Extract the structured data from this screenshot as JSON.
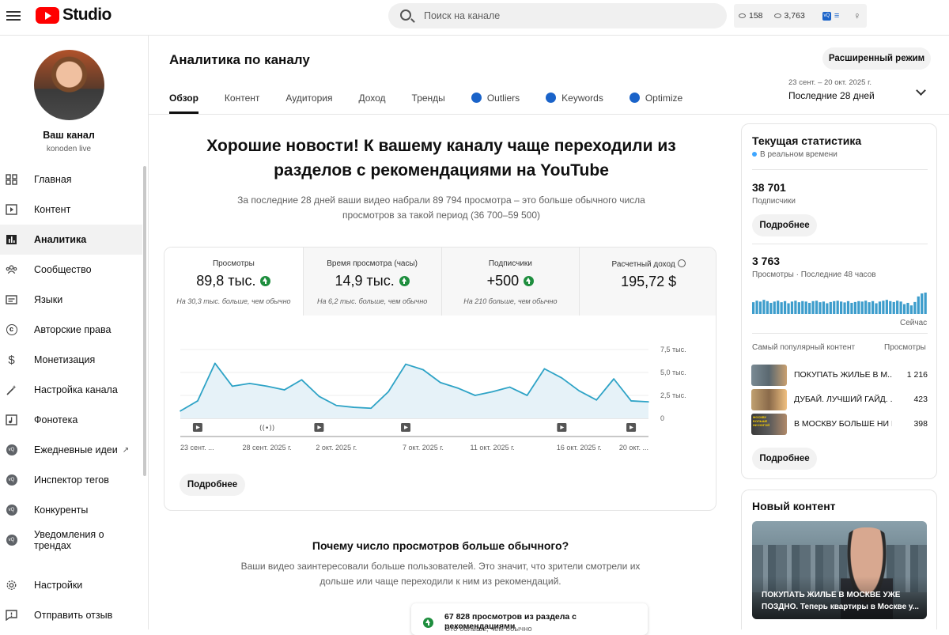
{
  "header": {
    "logo_text": "Studio",
    "search_placeholder": "Поиск на канале",
    "views_count": "158",
    "realtime_count": "3,763"
  },
  "sidebar": {
    "channel_name": "Ваш канал",
    "channel_handle": "konoden live",
    "items": [
      {
        "label": "Главная"
      },
      {
        "label": "Контент"
      },
      {
        "label": "Аналитика"
      },
      {
        "label": "Сообщество"
      },
      {
        "label": "Языки"
      },
      {
        "label": "Авторские права"
      },
      {
        "label": "Монетизация"
      },
      {
        "label": "Настройка канала"
      },
      {
        "label": "Фонотека"
      },
      {
        "label": "Ежедневные идеи"
      },
      {
        "label": "Инспектор тегов"
      },
      {
        "label": "Конкуренты"
      },
      {
        "label": "Уведомления о трендах"
      },
      {
        "label": "Настройки"
      },
      {
        "label": "Отправить отзыв"
      }
    ]
  },
  "main": {
    "title": "Аналитика по каналу",
    "advanced_button": "Расширенный режим",
    "tabs": [
      {
        "label": "Обзор"
      },
      {
        "label": "Контент"
      },
      {
        "label": "Аудитория"
      },
      {
        "label": "Доход"
      },
      {
        "label": "Тренды"
      },
      {
        "label": "Outliers"
      },
      {
        "label": "Keywords"
      },
      {
        "label": "Optimize"
      }
    ],
    "date_range": "23 сент. – 20 окт. 2025 г.",
    "date_label": "Последние 28 дней",
    "headline": "Хорошие новости! К вашему каналу чаще переходили из разделов с рекомендациями на YouTube",
    "subline": "За последние 28 дней ваши видео набрали 89 794 просмотра – это больше обычного числа просмотров за такой период (36 700–59 500)",
    "metrics": [
      {
        "title": "Просмотры",
        "value": "89,8 тыс.",
        "sub": "На 30,3 тыс. больше, чем обычно"
      },
      {
        "title": "Время просмотра (часы)",
        "value": "14,9 тыс.",
        "sub": "На 6,2 тыс. больше, чем обычно"
      },
      {
        "title": "Подписчики",
        "value": "+500",
        "sub": "На 210 больше, чем обычно"
      },
      {
        "title": "Расчетный доход",
        "value": "195,72 $",
        "sub": ""
      }
    ],
    "more_button": "Подробнее",
    "why_title": "Почему число просмотров больше обычного?",
    "why_sub": "Ваши видео заинтересовали больше пользователей. Это значит, что зрители смотрели их дольше или чаще переходили к ним из рекомендаций.",
    "rec_title": "67 828 просмотров из раздела с рекомендациями",
    "rec_sub": "Это больше, чем обычно"
  },
  "chart_data": {
    "type": "line",
    "x": [
      "23 сент.",
      "24 сент.",
      "25 сент.",
      "26 сент.",
      "27 сент.",
      "28 сент.",
      "29 сент.",
      "30 сент.",
      "1 окт.",
      "2 окт.",
      "3 окт.",
      "4 окт.",
      "5 окт.",
      "6 окт.",
      "7 окт.",
      "8 окт.",
      "9 окт.",
      "10 окт.",
      "11 окт.",
      "12 окт.",
      "13 окт.",
      "14 окт.",
      "15 окт.",
      "16 окт.",
      "17 окт.",
      "18 окт.",
      "19 окт.",
      "20 окт."
    ],
    "values": [
      800,
      1900,
      6000,
      3500,
      3800,
      3500,
      3100,
      4200,
      2400,
      1400,
      1200,
      1100,
      2900,
      5900,
      5300,
      3900,
      3300,
      2500,
      2900,
      3400,
      2500,
      5400,
      4400,
      3000,
      2000,
      4300,
      1900,
      1800
    ],
    "xtick_labels": [
      "23 сент. ...",
      "28 сент. 2025 г.",
      "2 окт. 2025 г.",
      "7 окт. 2025 г.",
      "11 окт. 2025 г.",
      "16 окт. 2025 г.",
      "20 окт. ..."
    ],
    "xtick_index": [
      0,
      5,
      9,
      14,
      18,
      23,
      27
    ],
    "ytick_labels": [
      "7,5 тыс.",
      "5,0 тыс.",
      "2,5 тыс.",
      "0"
    ],
    "ytick_values": [
      7500,
      5000,
      2500,
      0
    ],
    "ylim": [
      0,
      7500
    ],
    "markers": [
      {
        "index": 1,
        "kind": "video"
      },
      {
        "index": 8,
        "kind": "video"
      },
      {
        "index": 5,
        "kind": "live"
      },
      {
        "index": 13,
        "kind": "video"
      },
      {
        "index": 22,
        "kind": "video"
      },
      {
        "index": 26,
        "kind": "video"
      }
    ],
    "line_color": "#2ea3c6",
    "fill_color": "#e6f2f8",
    "grid": true
  },
  "realtime": {
    "title": "Текущая статистика",
    "live_label": "В реальном времени",
    "subscribers_value": "38 701",
    "subscribers_label": "Подписчики",
    "more_button": "Подробнее",
    "views_value": "3 763",
    "views_label": "Просмотры · Последние 48 часов",
    "now_label": "Сейчас",
    "bars": [
      0.55,
      0.62,
      0.58,
      0.66,
      0.6,
      0.52,
      0.58,
      0.62,
      0.55,
      0.6,
      0.5,
      0.58,
      0.62,
      0.55,
      0.6,
      0.58,
      0.52,
      0.6,
      0.62,
      0.55,
      0.58,
      0.5,
      0.56,
      0.6,
      0.62,
      0.58,
      0.54,
      0.6,
      0.52,
      0.56,
      0.6,
      0.58,
      0.62,
      0.55,
      0.6,
      0.5,
      0.58,
      0.62,
      0.66,
      0.6,
      0.56,
      0.62,
      0.58,
      0.46,
      0.52,
      0.4,
      0.56,
      0.82,
      0.96,
      1.0
    ],
    "top_header": "Самый популярный контент",
    "top_views_header": "Просмотры",
    "top_items": [
      {
        "title": "ПОКУПАТЬ ЖИЛЬЕ В М...",
        "views": "1 216"
      },
      {
        "title": "ДУБАЙ. ЛУЧШИЙ ГАЙД. ...",
        "views": "423"
      },
      {
        "title": "В МОСКВУ БОЛЬШЕ НИ Н...",
        "views": "398"
      }
    ],
    "top_thumb_text": "МОСКВУ БОЛЬШЕ НИ НОГОЙ"
  },
  "new_content": {
    "title": "Новый контент",
    "caption": "ПОКУПАТЬ ЖИЛЬЕ В МОСКВЕ УЖЕ ПОЗДНО. Теперь квартиры в Москве у..."
  }
}
